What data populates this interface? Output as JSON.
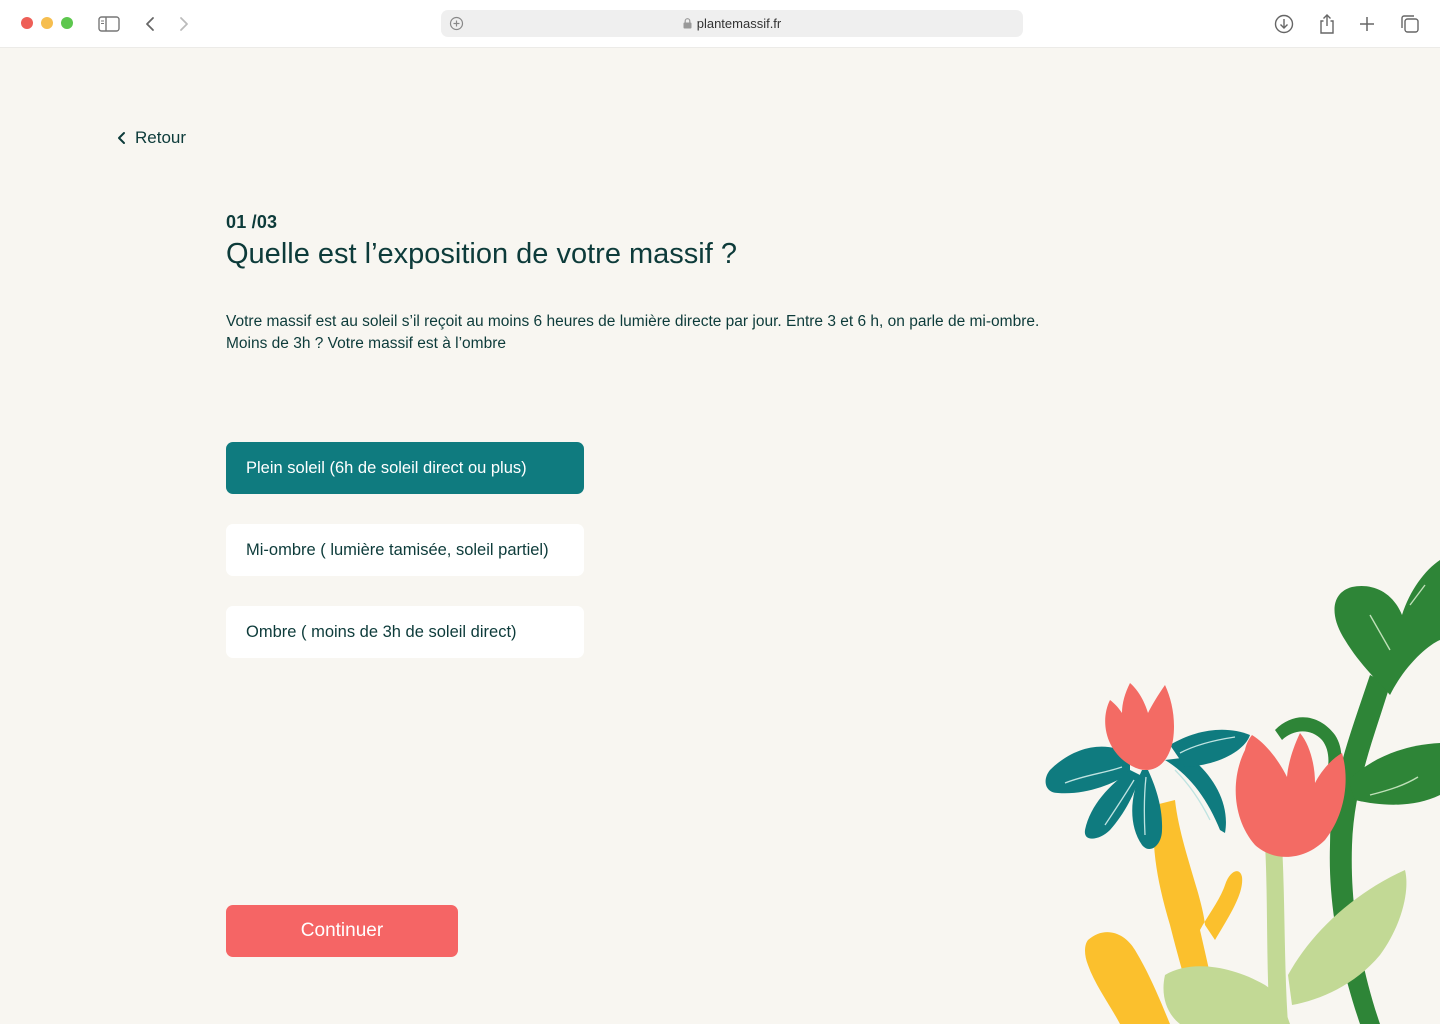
{
  "browser": {
    "url": "plantemassif.fr",
    "icons": [
      "sidebar-icon",
      "back-arrow-icon",
      "forward-arrow-icon",
      "shield-icon",
      "lock-icon",
      "download-icon",
      "share-icon",
      "new-tab-icon",
      "tabs-overview-icon"
    ]
  },
  "nav": {
    "back_label": "Retour"
  },
  "question": {
    "step": "01 /03",
    "title": "Quelle est l’exposition de votre massif ?",
    "description_line1": "Votre massif est au soleil s’il reçoit au moins 6 heures de lumière directe par jour. Entre 3 et 6 h, on parle de mi-ombre.",
    "description_line2": "Moins de 3h ? Votre massif est à l’ombre"
  },
  "options": [
    {
      "label": "Plein soleil (6h de soleil direct ou plus)",
      "selected": true
    },
    {
      "label": "Mi-ombre ( lumière tamisée, soleil partiel)",
      "selected": false
    },
    {
      "label": "Ombre ( moins de 3h de soleil direct)",
      "selected": false
    }
  ],
  "actions": {
    "continue_label": "Continuer"
  },
  "colors": {
    "background": "#f8f6f1",
    "text": "#0d3b3a",
    "selected_option": "#0f7b7f",
    "primary_button": "#f56565",
    "flower_red": "#f36b64",
    "flower_teal": "#0f7b7f",
    "leaf_green": "#2e8537",
    "stem_yellow": "#fbc02d",
    "leaf_light": "#c2d995"
  }
}
